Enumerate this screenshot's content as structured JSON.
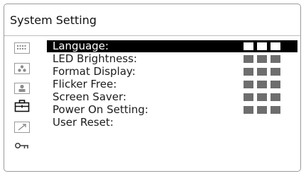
{
  "window": {
    "title": "System Setting"
  },
  "sidebar": {
    "icons": [
      {
        "name": "display-grid-icon"
      },
      {
        "name": "dots-icon"
      },
      {
        "name": "person-icon"
      },
      {
        "name": "toolbox-icon"
      },
      {
        "name": "arrow-icon"
      },
      {
        "name": "key-icon"
      }
    ]
  },
  "menu": {
    "items": [
      {
        "label": "Language:",
        "value_indicator": "■■■",
        "selected": true
      },
      {
        "label": "LED Brightness:",
        "value_indicator": "■■■",
        "selected": false
      },
      {
        "label": "Format Display:",
        "value_indicator": "■■■",
        "selected": false
      },
      {
        "label": "Flicker Free:",
        "value_indicator": "■■■",
        "selected": false
      },
      {
        "label": "Screen Saver:",
        "value_indicator": "■■■",
        "selected": false
      },
      {
        "label": "Power On Setting:",
        "value_indicator": "■■■",
        "selected": false
      },
      {
        "label": "User Reset:",
        "value_indicator": "",
        "selected": false
      }
    ]
  },
  "colors": {
    "selected_bg": "#000000",
    "selected_text": "#ffffff",
    "value_block": "#6e6e6e"
  }
}
